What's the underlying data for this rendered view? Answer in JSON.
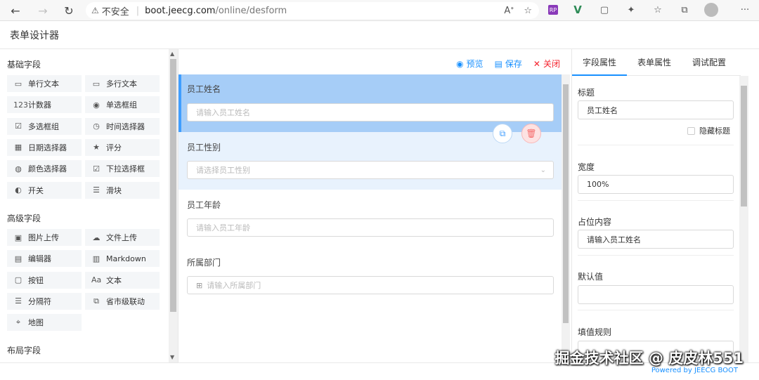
{
  "browser": {
    "insecure_label": "不安全",
    "url_host": "boot.jeecg.com",
    "url_path": "/online/desform",
    "ext_rp": "RP"
  },
  "app": {
    "title": "表单设计器"
  },
  "left": {
    "basic_title": "基础字段",
    "basic_items": [
      {
        "label": "单行文本",
        "icon": "▭"
      },
      {
        "label": "多行文本",
        "icon": "▭"
      },
      {
        "label": "计数器",
        "icon": "123"
      },
      {
        "label": "单选框组",
        "icon": "◉"
      },
      {
        "label": "多选框组",
        "icon": "☑"
      },
      {
        "label": "时间选择器",
        "icon": "◷"
      },
      {
        "label": "日期选择器",
        "icon": "▦"
      },
      {
        "label": "评分",
        "icon": "★"
      },
      {
        "label": "颜色选择器",
        "icon": "◍"
      },
      {
        "label": "下拉选择框",
        "icon": "☑"
      },
      {
        "label": "开关",
        "icon": "◐"
      },
      {
        "label": "滑块",
        "icon": "☰"
      }
    ],
    "advanced_title": "高级字段",
    "advanced_items": [
      {
        "label": "图片上传",
        "icon": "▣"
      },
      {
        "label": "文件上传",
        "icon": "☁"
      },
      {
        "label": "编辑器",
        "icon": "▤"
      },
      {
        "label": "Markdown",
        "icon": "▥"
      },
      {
        "label": "按钮",
        "icon": "▢"
      },
      {
        "label": "文本",
        "icon": "Aa"
      },
      {
        "label": "分隔符",
        "icon": "☰"
      },
      {
        "label": "省市级联动",
        "icon": "⧉"
      },
      {
        "label": "地图",
        "icon": "⌖"
      }
    ],
    "layout_title": "布局字段"
  },
  "toolbar": {
    "preview": "预览",
    "save": "保存",
    "close": "关闭"
  },
  "form": {
    "fields": [
      {
        "label": "员工姓名",
        "placeholder": "请输入员工姓名"
      },
      {
        "label": "员工性别",
        "placeholder": "请选择员工性别"
      },
      {
        "label": "员工年龄",
        "placeholder": "请输入员工年龄"
      },
      {
        "label": "所属部门",
        "placeholder": "请输入所属部门"
      }
    ]
  },
  "right": {
    "tabs": [
      "字段属性",
      "表单属性",
      "调试配置"
    ],
    "title_label": "标题",
    "title_value": "员工姓名",
    "hide_title": "隐藏标题",
    "width_label": "宽度",
    "width_value": "100%",
    "placeholder_label": "占位内容",
    "placeholder_value": "请输入员工姓名",
    "default_label": "默认值",
    "default_value": "",
    "rule_label": "填值规则"
  },
  "footer": {
    "watermark": "掘金技术社区 @ 皮皮林551",
    "powered": "Powered by JEECG BOOT"
  }
}
